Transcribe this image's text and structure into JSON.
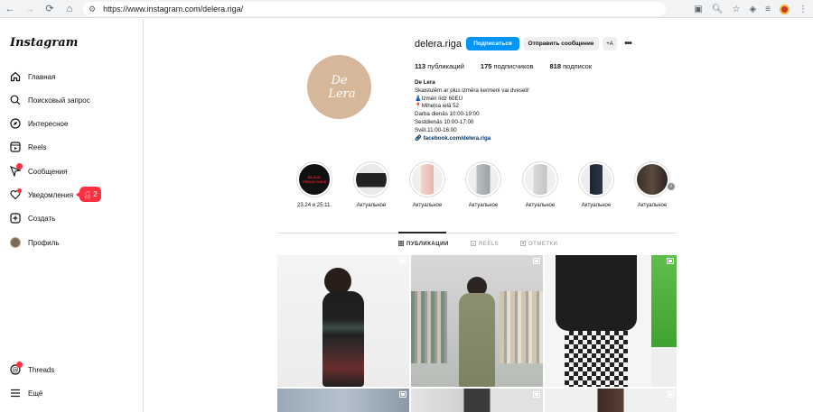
{
  "browser": {
    "url": "https://www.instagram.com/delera.riga/"
  },
  "sidebar": {
    "logo": "Instagram",
    "items": [
      {
        "label": "Главная",
        "icon": "home-icon"
      },
      {
        "label": "Поисковый запрос",
        "icon": "search-icon"
      },
      {
        "label": "Интересное",
        "icon": "compass-icon"
      },
      {
        "label": "Reels",
        "icon": "reels-icon"
      },
      {
        "label": "Сообщения",
        "icon": "messenger-icon"
      },
      {
        "label": "Уведомления",
        "icon": "heart-icon"
      },
      {
        "label": "Создать",
        "icon": "plus-square-icon"
      },
      {
        "label": "Профиль",
        "icon": "profile-avatar-icon"
      }
    ],
    "threads_label": "Threads",
    "more_label": "Ещё",
    "notif_count": "2"
  },
  "profile": {
    "avatar_text_1": "De",
    "avatar_text_2": "Lera",
    "username": "delera.riga",
    "follow_label": "Подписаться",
    "message_label": "Отправить сообщение",
    "add_label": "+A",
    "posts_count": "113",
    "posts_label": "публикаций",
    "followers_count": "175",
    "followers_label": "подписчиков",
    "following_count": "818",
    "following_label": "подписок",
    "bio_name": "De Lera",
    "bio_lines": [
      "Skaistulēm ar plus izmēra ķermeni vai dveseli!",
      "👗Izmēri līdz 60EU",
      "📍Miheļsa ielā 52",
      "Darba dienās 10:00-19:00",
      "Sestdienās 10:00-17:00",
      "Svēt.11:00-16:00"
    ],
    "bio_link": "facebook.com/delera.riga"
  },
  "highlights": [
    {
      "label": "23,24 и 25.11."
    },
    {
      "label": "Актуальное"
    },
    {
      "label": "Актуальное"
    },
    {
      "label": "Актуальное"
    },
    {
      "label": "Актуальное"
    },
    {
      "label": "Актуальное"
    },
    {
      "label": "Актуальное"
    }
  ],
  "highlight_cover_text": "BLACK FRIDAY SALE",
  "tabs": [
    {
      "label": "ПУБЛИКАЦИИ",
      "icon": "grid-icon"
    },
    {
      "label": "REELS",
      "icon": "reels-icon"
    },
    {
      "label": "ОТМЕТКИ",
      "icon": "tag-icon"
    }
  ]
}
